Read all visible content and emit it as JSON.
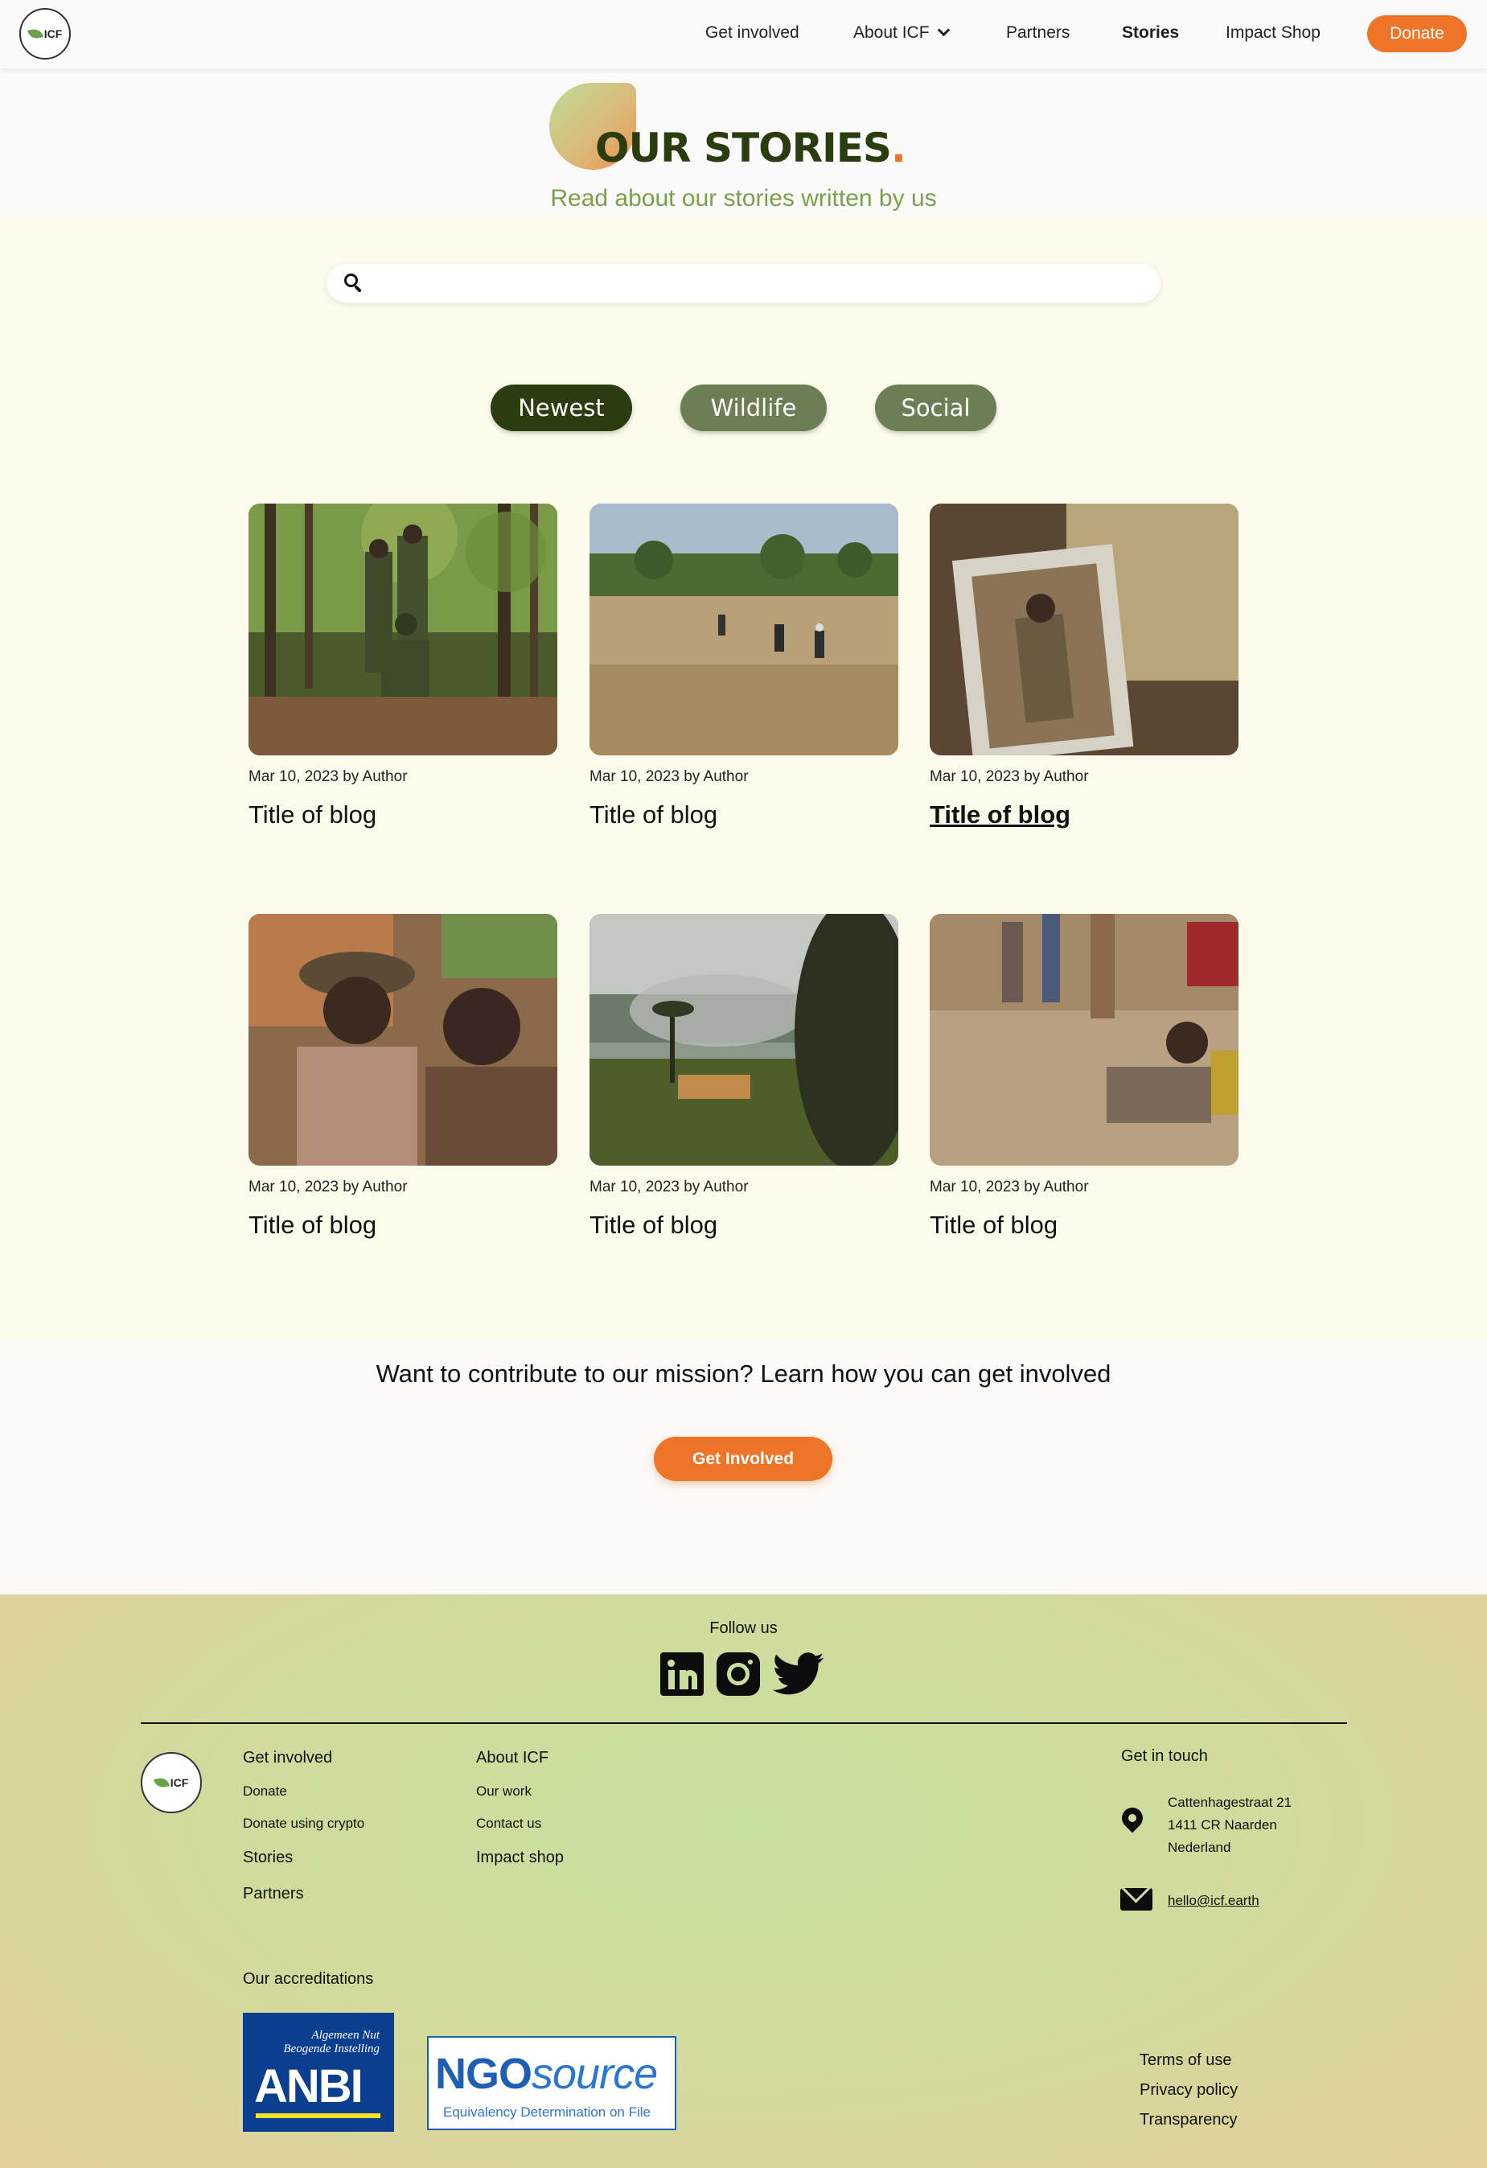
{
  "nav": {
    "logo_text": "ICF",
    "links": [
      "Get involved",
      "About ICF",
      "Partners",
      "Stories",
      "Impact Shop"
    ],
    "active": "Stories",
    "donate": "Donate"
  },
  "hero": {
    "title": "OUR STORIES",
    "title_dot": ".",
    "subtitle": "Read about our stories written by us"
  },
  "search": {
    "placeholder": "",
    "value": ""
  },
  "filters": [
    "Newest",
    "Wildlife",
    "Social"
  ],
  "posts": [
    {
      "meta": "Mar 10, 2023 by Author",
      "title": "Title of blog",
      "image": "rangers-in-forest-photo"
    },
    {
      "meta": "Mar 10, 2023 by Author",
      "title": "Title of blog",
      "image": "patrol-in-grassland-photo"
    },
    {
      "meta": "Mar 10, 2023 by Author",
      "title": "Title of blog",
      "image": "memorial-framed-photo"
    },
    {
      "meta": "Mar 10, 2023 by Author",
      "title": "Title of blog",
      "image": "village-elders-photo"
    },
    {
      "meta": "Mar 10, 2023 by Author",
      "title": "Title of blog",
      "image": "savanna-fire-photo"
    },
    {
      "meta": "Mar 10, 2023 by Author",
      "title": "Title of blog",
      "image": "children-village-photo"
    }
  ],
  "cta": {
    "text": "Want to contribute to our mission? Learn how you can get involved",
    "button": "Get Involved"
  },
  "footer": {
    "follow": "Follow us",
    "social": [
      "linkedin-icon",
      "instagram-icon",
      "twitter-icon"
    ],
    "col1": {
      "head": "Get involved",
      "links": [
        "Donate",
        "Donate using crypto"
      ],
      "extra": [
        "Stories",
        "Partners"
      ]
    },
    "col2": {
      "head": "About ICF",
      "links": [
        "Our work",
        "Contact us"
      ],
      "extra": [
        "Impact shop"
      ]
    },
    "contact": {
      "head": "Get in touch",
      "address": [
        "Cattenhagestraat 21",
        "1411 CR Naarden",
        "Nederland"
      ],
      "email": "hello@icf.earth"
    },
    "accreditations": {
      "head": "Our accreditations",
      "anbi_line1": "Algemeen Nut",
      "anbi_line2": "Beogende Instelling",
      "anbi": "ANBI",
      "ngo_bold": "NGO",
      "ngo_light": "source",
      "ngo_sub": "Equivalency Determination on File"
    },
    "legal": [
      "Terms of use",
      "Privacy policy",
      "Transparency"
    ]
  },
  "colors": {
    "accent": "#ee7528",
    "dark_green": "#2b3c0f",
    "muted_green": "#6c7e53",
    "cream": "#fdfcec"
  }
}
